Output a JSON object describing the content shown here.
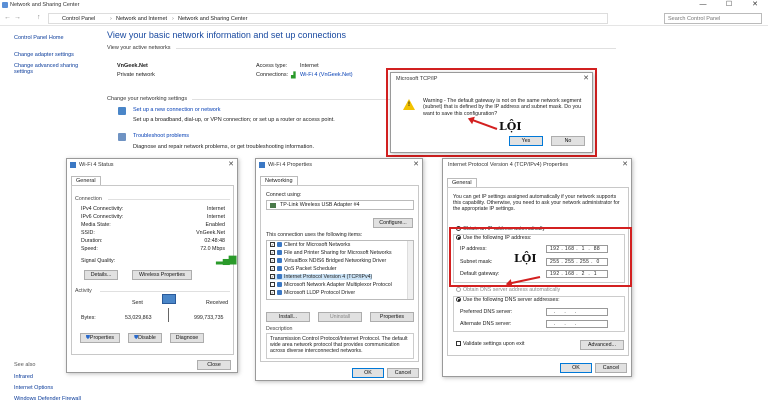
{
  "window": {
    "title": "Network and Sharing Center",
    "min": "—",
    "max": "☐",
    "close": "✕"
  },
  "address": {
    "back": "←",
    "forward": "→",
    "up": "↑",
    "crumbs": [
      "Control Panel",
      "Network and Internet",
      "Network and Sharing Center"
    ],
    "search_placeholder": "Search Control Panel"
  },
  "left_pane": {
    "home": "Control Panel Home",
    "adapter": "Change adapter settings",
    "advanced": "Change advanced sharing settings",
    "see_also": "See also",
    "infrared": "Infrared",
    "internet_options": "Internet Options",
    "firewall": "Windows Defender Firewall"
  },
  "main": {
    "heading": "View your basic network information and set up connections",
    "active_label": "View your active networks",
    "network_name": "VnGeek.Net",
    "network_type": "Private network",
    "access_type_label": "Access type:",
    "access_type": "Internet",
    "connections_label": "Connections:",
    "connection": "Wi-Fi 4 (VnGeek.Net)",
    "change_label": "Change your networking settings",
    "setup_link": "Set up a new connection or network",
    "setup_desc": "Set up a broadband, dial-up, or VPN connection; or set up a router or access point.",
    "trouble_link": "Troubleshoot problems",
    "trouble_desc": "Diagnose and repair network problems, or get troubleshooting information."
  },
  "tcpip_warning": {
    "title": "Microsoft TCP/IP",
    "message": "Warning - The default gateway is not on the same network segment (subnet) that is defined by the IP address and subnet mask. Do you want to save this configuration?",
    "yes": "Yes",
    "no": "No"
  },
  "wifi_status": {
    "title": "Wi-Fi 4 Status",
    "tab": "General",
    "connection_label": "Connection",
    "rows": [
      {
        "label": "IPv4 Connectivity:",
        "value": "Internet"
      },
      {
        "label": "IPv6 Connectivity:",
        "value": "Internet"
      },
      {
        "label": "Media State:",
        "value": "Enabled"
      },
      {
        "label": "SSID:",
        "value": "VnGeek.Net"
      },
      {
        "label": "Duration:",
        "value": "02:48:48"
      },
      {
        "label": "Speed:",
        "value": "72.0 Mbps"
      }
    ],
    "signal_label": "Signal Quality:",
    "details": "Details...",
    "wireless_props": "Wireless Properties",
    "activity_label": "Activity",
    "sent": "Sent",
    "received": "Received",
    "bytes_label": "Bytes:",
    "bytes_sent": "53,029,863",
    "bytes_received": "999,733,735",
    "properties": "Properties",
    "disable": "Disable",
    "diagnose": "Diagnose",
    "close": "Close"
  },
  "wifi_props": {
    "title": "Wi-Fi 4 Properties",
    "tab": "Networking",
    "connect_using": "Connect using:",
    "adapter": "TP-Link Wireless USB Adapter #4",
    "configure": "Configure...",
    "items_label": "This connection uses the following items:",
    "items": [
      {
        "checked": "✓",
        "label": "Client for Microsoft Networks"
      },
      {
        "checked": "✓",
        "label": "File and Printer Sharing for Microsoft Networks"
      },
      {
        "checked": "✓",
        "label": "VirtualBox NDIS6 Bridged Networking Driver"
      },
      {
        "checked": "✓",
        "label": "QoS Packet Scheduler"
      },
      {
        "checked": "✓",
        "label": "Internet Protocol Version 4 (TCP/IPv4)"
      },
      {
        "checked": "",
        "label": "Microsoft Network Adapter Multiplexor Protocol"
      },
      {
        "checked": "✓",
        "label": "Microsoft LLDP Protocol Driver"
      }
    ],
    "install": "Install...",
    "uninstall": "Uninstall",
    "properties": "Properties",
    "description_label": "Description",
    "description": "Transmission Control Protocol/Internet Protocol. The default wide area network protocol that provides communication across diverse interconnected networks.",
    "ok": "OK",
    "cancel": "Cancel"
  },
  "ipv4": {
    "title": "Internet Protocol Version 4 (TCP/IPv4) Properties",
    "tab": "General",
    "intro": "You can get IP settings assigned automatically if your network supports this capability. Otherwise, you need to ask your network administrator for the appropriate IP settings.",
    "obtain_auto": "Obtain an IP address automatically",
    "use_following": "Use the following IP address:",
    "ip_label": "IP address:",
    "ip_value": "192 . 168 .  1  .  88",
    "mask_label": "Subnet mask:",
    "mask_value": "255 . 255 . 255 .  0",
    "gateway_label": "Default gateway:",
    "gateway_value": "192 . 168 .  2  .  1",
    "obtain_dns": "Obtain DNS server address automatically",
    "use_dns": "Use the following DNS server addresses:",
    "preferred_dns": "Preferred DNS server:",
    "alternate_dns": "Alternate DNS server:",
    "dns_blank": "  .     .     .",
    "validate": "Validate settings upon exit",
    "advanced": "Advanced...",
    "ok": "OK",
    "cancel": "Cancel"
  },
  "logo_text": "LỘI"
}
